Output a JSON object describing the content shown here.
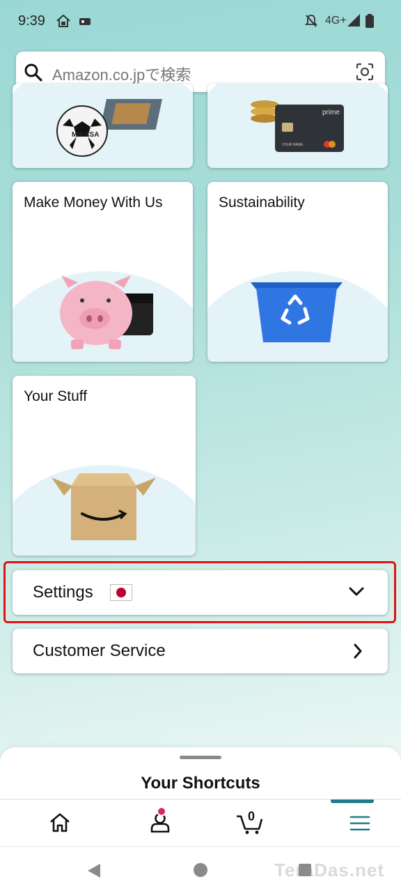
{
  "status_bar": {
    "time": "9:39",
    "network": "4G+"
  },
  "search": {
    "placeholder": "Amazon.co.jpで検索"
  },
  "cards": [
    {
      "title": "Make Money With Us"
    },
    {
      "title": "Sustainability"
    },
    {
      "title": "Your Stuff"
    }
  ],
  "card_fragments": {
    "ball_brand": "MIKASA",
    "card_brand": "prime",
    "card_holder": "YOUR NAME"
  },
  "settings": {
    "label": "Settings",
    "flag": "Japan"
  },
  "customer_service": {
    "label": "Customer Service"
  },
  "shortcuts": {
    "title": "Your Shortcuts"
  },
  "bottom_nav": {
    "items": [
      "home-icon",
      "account-icon",
      "cart-icon",
      "menu-icon"
    ],
    "cart_count": "0",
    "active": "menu"
  },
  "watermark": "TeraDas.net",
  "colors": {
    "accent": "#1f7a8c",
    "highlight": "#e01212",
    "badge": "#d7266b"
  }
}
